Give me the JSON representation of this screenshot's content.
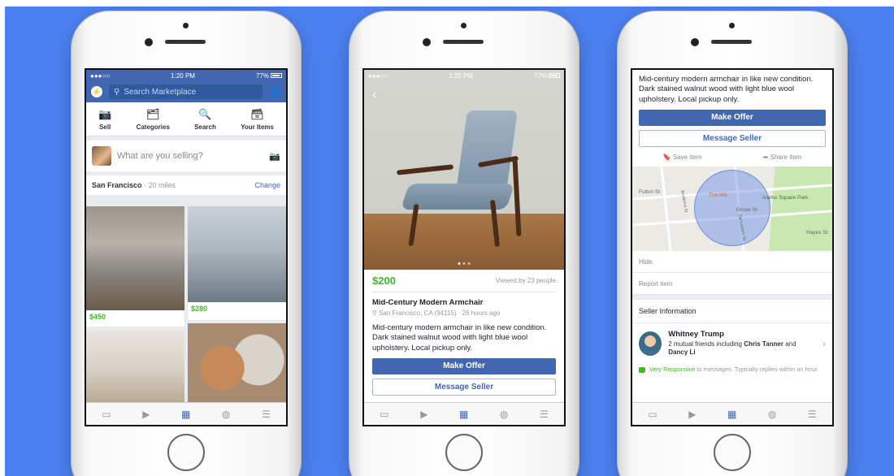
{
  "status": {
    "carrier": "●●●○○",
    "time": "1:20 PM",
    "battery": "77%"
  },
  "screen1": {
    "search_placeholder": "Search Marketplace",
    "icons": [
      {
        "label": "Sell",
        "icon": "camera-icon"
      },
      {
        "label": "Categories",
        "icon": "categories-icon"
      },
      {
        "label": "Search",
        "icon": "search-icon"
      },
      {
        "label": "Your Items",
        "icon": "your-items-icon"
      }
    ],
    "sell_placeholder": "What are you selling?",
    "location": "San Francisco",
    "distance": "· 20 miles",
    "change": "Change",
    "listings": [
      {
        "price": "$450"
      },
      {
        "price": "$280"
      }
    ]
  },
  "screen2": {
    "price": "$200",
    "viewed": "Viewed by 23 people",
    "title": "Mid-Century Modern Armchair",
    "meta": "San Francisco, CA (94115) · 26 hours ago",
    "description": "Mid-century modern armchair in like new condition. Dark stained walnut wood with light blue wool upholstery. Local pickup only.",
    "make_offer": "Make Offer",
    "message_seller": "Message Seller"
  },
  "screen3": {
    "description": "Mid-century modern armchair in like new condition. Dark stained walnut wood with light blue wool upholstery. Local pickup only.",
    "make_offer": "Make Offer",
    "message_seller": "Message Seller",
    "save_item": "Save item",
    "share_item": "Share item",
    "map_labels": {
      "fulton": "Fulton St",
      "grove": "Grove St",
      "mill": "The Mill",
      "park": "Alamo Square Park",
      "divisadero": "Divisadero St",
      "broderick": "Broderick St",
      "hayes": "Hayes St"
    },
    "hide": "Hide",
    "report": "Report item",
    "seller_info": "Seller Information",
    "seller_name": "Whitney Trump",
    "mutual_prefix": "2 mutual friends including ",
    "mutual_friend1": "Chris Tanner",
    "mutual_and": " and ",
    "mutual_friend2": "Dancy Li",
    "responsive": "Very Responsive",
    "responsive_rest": " to messages. Typically replies within an hour."
  },
  "tabbar": [
    "home-icon",
    "video-icon",
    "marketplace-icon",
    "globe-icon",
    "menu-icon"
  ]
}
